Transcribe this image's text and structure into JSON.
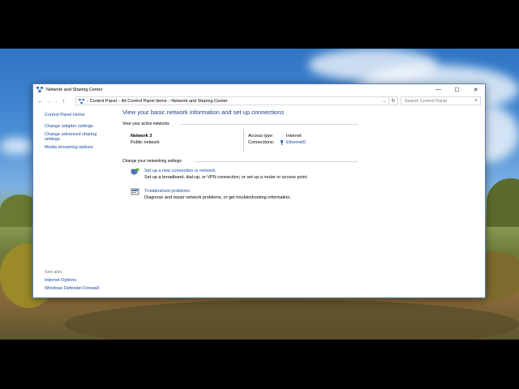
{
  "window": {
    "title": "Network and Sharing Center",
    "controls": {
      "minimize": "—",
      "maximize": "☐",
      "close": "✕"
    }
  },
  "address": {
    "crumbs": [
      "Control Panel",
      "All Control Panel Items",
      "Network and Sharing Center"
    ],
    "search_placeholder": "Search Control Panel"
  },
  "left_pane": {
    "links": [
      "Control Panel Home",
      "Change adapter settings",
      "Change advanced sharing settings",
      "Media streaming options"
    ],
    "see_also_title": "See also",
    "see_also": [
      "Internet Options",
      "Windows Defender Firewall"
    ]
  },
  "main": {
    "heading": "View your basic network information and set up connections",
    "active_networks_label": "View your active networks",
    "network": {
      "name": "Network 3",
      "type": "Public network",
      "access_type_label": "Access type:",
      "access_type_value": "Internet",
      "connections_label": "Connections:",
      "connections_value": "Ethernet0"
    },
    "settings_label": "Change your networking settings",
    "tasks": [
      {
        "icon": "network-setup-icon",
        "title": "Set up a new connection or network",
        "desc": "Set up a broadband, dial-up, or VPN connection; or set up a router or access point."
      },
      {
        "icon": "troubleshoot-icon",
        "title": "Troubleshoot problems",
        "desc": "Diagnose and repair network problems, or get troubleshooting information."
      }
    ]
  }
}
